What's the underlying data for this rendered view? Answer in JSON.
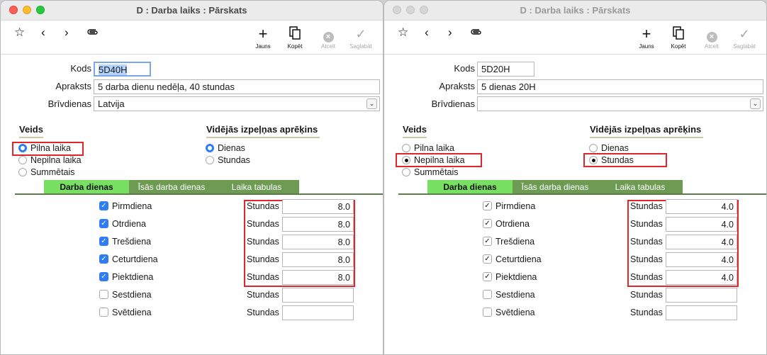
{
  "windows": [
    {
      "title": "D : Darba laiks : Pārskats",
      "toolbar": {
        "new": "Jauns",
        "copy": "Kopēt",
        "cancel": "Atcelt",
        "save": "Saglabāt"
      },
      "form": {
        "kods_label": "Kods",
        "kods_value": "5D40H",
        "apraksts_label": "Apraksts",
        "apraksts_value": "5 darba dienu nedēļa, 40 stundas",
        "brivdienas_label": "Brīvdienas",
        "brivdienas_value": "Latvija"
      },
      "veids": {
        "title": "Veids",
        "options": [
          "Pilna laika",
          "Nepilna laika",
          "Summētais"
        ],
        "selected": "Pilna laika"
      },
      "avg": {
        "title": "Vidējās izpeļņas aprēķins",
        "options": [
          "Dienas",
          "Stundas"
        ],
        "selected": "Dienas"
      },
      "tabs": [
        "Darba dienas",
        "Īsās darba dienas",
        "Laika tabulas"
      ],
      "hours_label": "Stundas",
      "days": [
        {
          "name": "Pirmdiena",
          "checked": true,
          "hours": "8.0"
        },
        {
          "name": "Otrdiena",
          "checked": true,
          "hours": "8.0"
        },
        {
          "name": "Trešdiena",
          "checked": true,
          "hours": "8.0"
        },
        {
          "name": "Ceturtdiena",
          "checked": true,
          "hours": "8.0"
        },
        {
          "name": "Piektdiena",
          "checked": true,
          "hours": "8.0"
        },
        {
          "name": "Sestdiena",
          "checked": false,
          "hours": ""
        },
        {
          "name": "Svētdiena",
          "checked": false,
          "hours": ""
        }
      ]
    },
    {
      "title": "D : Darba laiks : Pārskats",
      "toolbar": {
        "new": "Jauns",
        "copy": "Kopēt",
        "cancel": "Atcelt",
        "save": "Saglabāt"
      },
      "form": {
        "kods_label": "Kods",
        "kods_value": "5D20H",
        "apraksts_label": "Apraksts",
        "apraksts_value": "5 dienas 20H",
        "brivdienas_label": "Brīvdienas",
        "brivdienas_value": ""
      },
      "veids": {
        "title": "Veids",
        "options": [
          "Pilna laika",
          "Nepilna laika",
          "Summētais"
        ],
        "selected": "Nepilna laika"
      },
      "avg": {
        "title": "Vidējās izpeļņas aprēķins",
        "options": [
          "Dienas",
          "Stundas"
        ],
        "selected": "Stundas"
      },
      "tabs": [
        "Darba dienas",
        "Īsās darba dienas",
        "Laika tabulas"
      ],
      "hours_label": "Stundas",
      "days": [
        {
          "name": "Pirmdiena",
          "checked": true,
          "hours": "4.0"
        },
        {
          "name": "Otrdiena",
          "checked": true,
          "hours": "4.0"
        },
        {
          "name": "Trešdiena",
          "checked": true,
          "hours": "4.0"
        },
        {
          "name": "Ceturtdiena",
          "checked": true,
          "hours": "4.0"
        },
        {
          "name": "Piektdiena",
          "checked": true,
          "hours": "4.0"
        },
        {
          "name": "Sestdiena",
          "checked": false,
          "hours": ""
        },
        {
          "name": "Svētdiena",
          "checked": false,
          "hours": ""
        }
      ]
    }
  ],
  "colors": {
    "highlight": "#e0262a",
    "tab_active": "#77e063",
    "tab_inactive": "#6e9b54",
    "radio_blue": "#2f7cf6"
  }
}
